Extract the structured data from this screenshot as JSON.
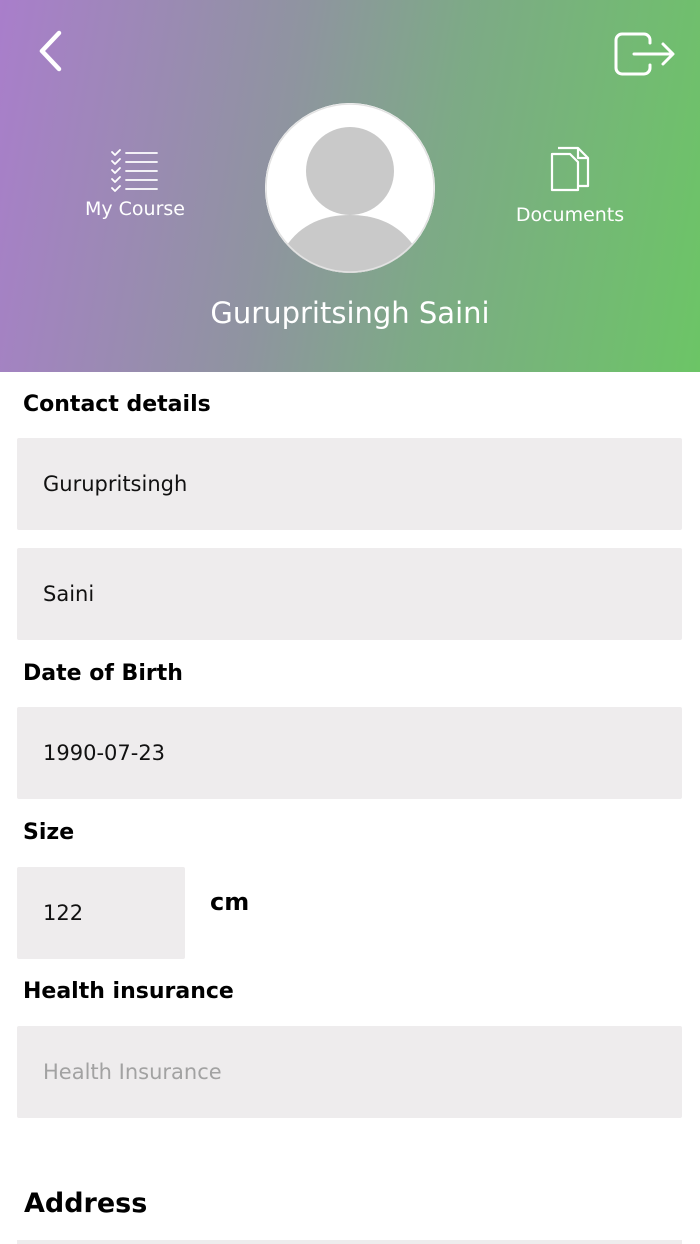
{
  "header": {
    "user_name": "Gurupritsingh Saini",
    "my_course_label": "My Course",
    "documents_label": "Documents",
    "gradient_start": "#a97ecb",
    "gradient_end": "#6cc566"
  },
  "contact": {
    "title": "Contact details",
    "first_name": "Gurupritsingh",
    "last_name": "Saini"
  },
  "birth": {
    "title": "Date of Birth",
    "value": "1990-07-23"
  },
  "size": {
    "title": "Size",
    "value": "122",
    "unit": "cm"
  },
  "insurance": {
    "title": "Health insurance",
    "placeholder": "Health Insurance"
  },
  "address": {
    "title": "Address"
  }
}
